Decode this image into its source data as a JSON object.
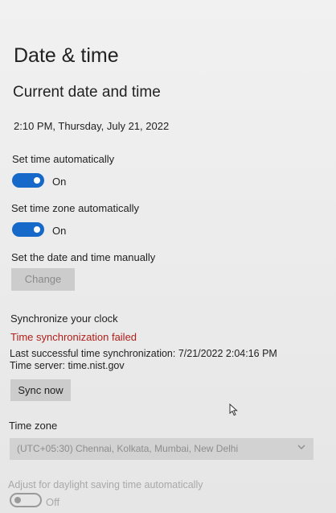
{
  "page_title": "Date & time",
  "section_title": "Current date and time",
  "current_datetime": "2:10 PM, Thursday, July 21, 2022",
  "set_time_automatically": {
    "label": "Set time automatically",
    "state": "On"
  },
  "set_time_zone_automatically": {
    "label": "Set time zone automatically",
    "state": "On"
  },
  "manual": {
    "label": "Set the date and time manually",
    "button": "Change"
  },
  "sync": {
    "title": "Synchronize your clock",
    "status": "Time synchronization failed",
    "last_success": "Last successful time synchronization: 7/21/2022 2:04:16 PM",
    "server": "Time server: time.nist.gov",
    "button": "Sync now"
  },
  "time_zone": {
    "label": "Time zone",
    "selected": "(UTC+05:30) Chennai, Kolkata, Mumbai, New Delhi"
  },
  "dst": {
    "label": "Adjust for daylight saving time automatically",
    "state": "Off"
  },
  "colors": {
    "accent": "#1769c9",
    "error": "#b0201a",
    "disabled_text": "#8a8a8a"
  },
  "icons": {
    "dropdown": "chevron-down-icon",
    "pointer": "mouse-cursor-icon"
  }
}
